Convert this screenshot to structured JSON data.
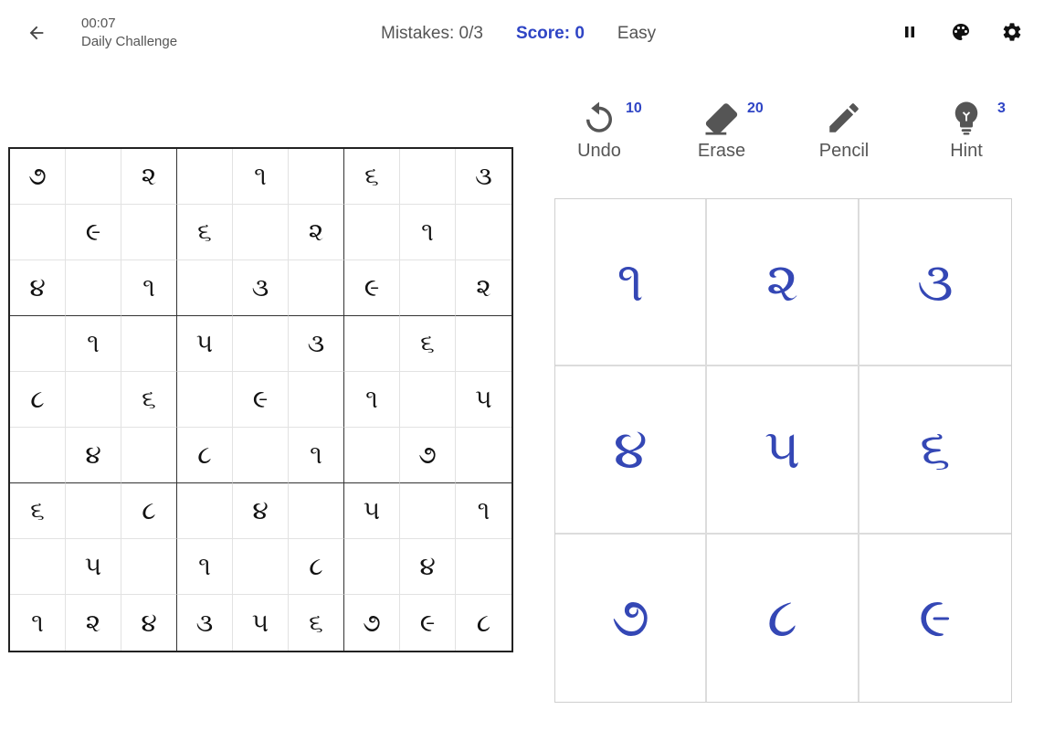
{
  "header": {
    "back_icon": "arrow-left-icon",
    "timer": "00:07",
    "subtitle": "Daily Challenge",
    "mistakes": "Mistakes: 0/3",
    "score": "Score: 0",
    "difficulty": "Easy",
    "icons": [
      "pause-icon",
      "palette-icon",
      "gear-icon"
    ]
  },
  "tools": [
    {
      "id": "undo",
      "label": "Undo",
      "badge": "10",
      "icon": "undo-icon"
    },
    {
      "id": "erase",
      "label": "Erase",
      "badge": "20",
      "icon": "eraser-icon"
    },
    {
      "id": "pencil",
      "label": "Pencil",
      "badge": "",
      "icon": "pencil-icon"
    },
    {
      "id": "hint",
      "label": "Hint",
      "badge": "3",
      "icon": "lightbulb-icon"
    }
  ],
  "board": [
    [
      "૭",
      "",
      "૨",
      "",
      "૧",
      "",
      "૬",
      "",
      "૩"
    ],
    [
      "",
      "૯",
      "",
      "૬",
      "",
      "૨",
      "",
      "૧",
      ""
    ],
    [
      "૪",
      "",
      "૧",
      "",
      "૩",
      "",
      "૯",
      "",
      "૨"
    ],
    [
      "",
      "૧",
      "",
      "૫",
      "",
      "૩",
      "",
      "૬",
      ""
    ],
    [
      "૮",
      "",
      "૬",
      "",
      "૯",
      "",
      "૧",
      "",
      "૫"
    ],
    [
      "",
      "૪",
      "",
      "૮",
      "",
      "૧",
      "",
      "૭",
      ""
    ],
    [
      "૬",
      "",
      "૮",
      "",
      "૪",
      "",
      "૫",
      "",
      "૧"
    ],
    [
      "",
      "૫",
      "",
      "૧",
      "",
      "૮",
      "",
      "૪",
      ""
    ],
    [
      "૧",
      "૨",
      "૪",
      "૩",
      "૫",
      "૬",
      "૭",
      "૯",
      "૮"
    ]
  ],
  "numpad": [
    "૧",
    "૨",
    "૩",
    "૪",
    "૫",
    "૬",
    "૭",
    "૮",
    "૯"
  ],
  "colors": {
    "accent": "#2f45c5",
    "numpad_digit": "#3447b5"
  }
}
